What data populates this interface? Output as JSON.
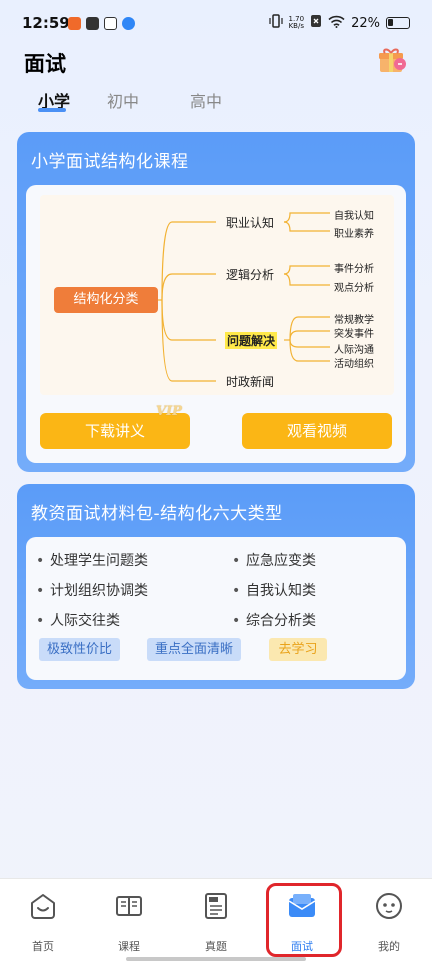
{
  "status_bar": {
    "time": "12:59",
    "speed_top": "1.70",
    "speed_bottom": "KB/s",
    "battery": "22%"
  },
  "header": {
    "title": "面试",
    "tabs": [
      {
        "label": "小学",
        "active": true
      },
      {
        "label": "初中",
        "active": false
      },
      {
        "label": "高中",
        "active": false
      }
    ]
  },
  "card1": {
    "title": "小学面试结构化课程",
    "mindmap": {
      "root": "结构化分类",
      "nodes": [
        "职业认知",
        "逻辑分析",
        "问题解决",
        "时政新闻"
      ],
      "leaves": {
        "career": [
          "自我认知",
          "职业素养"
        ],
        "logic": [
          "事件分析",
          "观点分析"
        ],
        "problem": [
          "常规教学",
          "突发事件",
          "人际沟通",
          "活动组织"
        ]
      }
    },
    "download_label": "下载讲义",
    "vip_label": "VIP",
    "video_label": "观看视频"
  },
  "card2": {
    "title": "教资面试材料包-结构化六大类型",
    "items": [
      "处理学生问题类",
      "应急应变类",
      "计划组织协调类",
      "自我认知类",
      "人际交往类",
      "综合分析类"
    ],
    "tags": [
      "极致性价比",
      "重点全面清晰"
    ],
    "study_label": "去学习"
  },
  "bottom_nav": [
    {
      "label": "首页",
      "icon": "home-smile-icon"
    },
    {
      "label": "课程",
      "icon": "book-icon"
    },
    {
      "label": "真题",
      "icon": "exam-paper-icon"
    },
    {
      "label": "面试",
      "icon": "interview-envelope-icon",
      "active": true
    },
    {
      "label": "我的",
      "icon": "profile-face-icon"
    }
  ],
  "colors": {
    "accent": "#4a90f5",
    "card_blue": "#5b9cf8",
    "button_orange": "#fbb615",
    "highlight_red": "#e0262b"
  }
}
